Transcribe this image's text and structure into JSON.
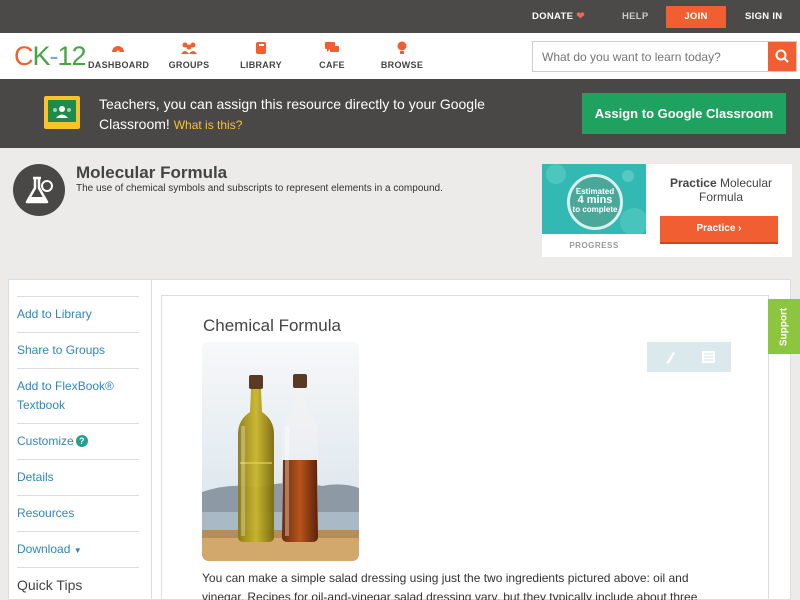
{
  "topbar": {
    "donate": "DONATE",
    "help": "HELP",
    "join": "JOIN",
    "signin": "SIGN IN"
  },
  "nav": {
    "logo": {
      "c": "C",
      "k": "K",
      "dash": "-",
      "n": "12"
    },
    "items": [
      {
        "label": "DASHBOARD",
        "icon": "dashboard-icon"
      },
      {
        "label": "GROUPS",
        "icon": "groups-icon"
      },
      {
        "label": "LIBRARY",
        "icon": "library-icon"
      },
      {
        "label": "CAFE",
        "icon": "cafe-icon"
      },
      {
        "label": "BROWSE",
        "icon": "browse-icon"
      }
    ],
    "search_placeholder": "What do you want to learn today?"
  },
  "banner": {
    "text": "Teachers, you can assign this resource directly to your Google Classroom!",
    "link": "What is this?",
    "button": "Assign to Google Classroom"
  },
  "concept": {
    "title": "Molecular Formula",
    "description": "The use of chemical symbols and subscripts to represent elements in a compound."
  },
  "practice": {
    "estimate_line1": "Estimated",
    "estimate_line2": "4 mins",
    "estimate_line3": "to complete",
    "progress_label": "PROGRESS",
    "title_bold": "Practice",
    "title_rest": "Molecular Formula",
    "button": "Practice"
  },
  "sidebar": {
    "items": [
      "Add to Library",
      "Share to Groups",
      "Add to FlexBook® Textbook",
      "Customize",
      "Details",
      "Resources",
      "Download"
    ],
    "help_mark": "?",
    "download_caret": "▼",
    "quick_tips": "Quick Tips"
  },
  "article": {
    "title": "Chemical Formula",
    "text": "You can make a simple salad dressing using just the two ingredients pictured above: oil and vinegar. Recipes for oil-and-vinegar salad dressing vary, but they typically include about three"
  },
  "support": "Support",
  "colors": {
    "accent_orange": "#f15e32",
    "google_green": "#1fa160",
    "link_blue": "#2f86b8",
    "support_green": "#8cc63f"
  }
}
